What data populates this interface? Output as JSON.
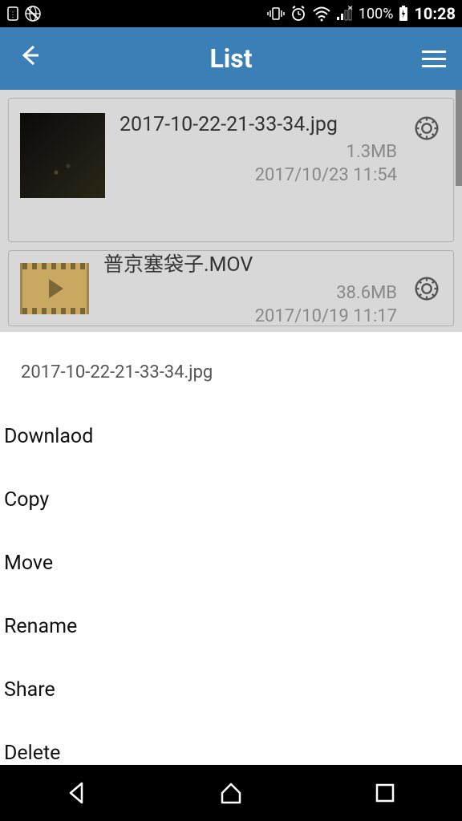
{
  "status": {
    "battery_text": "100%",
    "time": "10:28"
  },
  "header": {
    "title": "List"
  },
  "files": [
    {
      "name": "2017-10-22-21-33-34.jpg",
      "size": "1.3MB",
      "date": "2017/10/23 11:54"
    },
    {
      "name": "普京塞袋子.MOV",
      "size": "38.6MB",
      "date": "2017/10/19 11:17"
    }
  ],
  "sheet": {
    "title": "2017-10-22-21-33-34.jpg",
    "actions": {
      "download": "Downlaod",
      "copy": "Copy",
      "move": "Move",
      "rename": "Rename",
      "share": "Share",
      "delete": "Delete"
    }
  }
}
